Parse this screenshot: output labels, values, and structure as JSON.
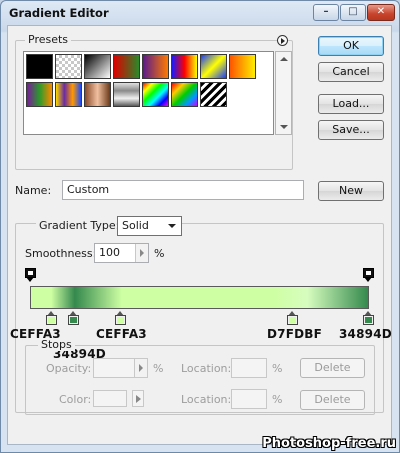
{
  "window": {
    "title": "Gradient Editor",
    "minimize_glyph": "–",
    "maximize_glyph": "□",
    "close_glyph": "✕"
  },
  "presets": {
    "label": "Presets",
    "swatches": [
      {
        "name": "black-fill",
        "background": "#000000"
      },
      {
        "name": "checker-transparent",
        "background": "repeating-conic-gradient(#c8c8c8 0% 25%, #ffffff 0% 50%) 0 0/6px 6px"
      },
      {
        "name": "black-to-white",
        "background": "linear-gradient(135deg,#000,#fff)"
      },
      {
        "name": "red-green",
        "background": "linear-gradient(to right,#d00,#2a8a2a)"
      },
      {
        "name": "violet-orange",
        "background": "linear-gradient(to right,#5a1a8a,#ff7a00)"
      },
      {
        "name": "blue-red-yellow",
        "background": "linear-gradient(to right,#1a1aff,#ff0000,#ffff00)"
      },
      {
        "name": "blue-yellow-blue",
        "background": "linear-gradient(135deg,#1a3cff,#ffff00,#1a3cff)"
      },
      {
        "name": "orange-yellow",
        "background": "linear-gradient(to right,#ff5500,#ffee00)"
      },
      {
        "name": "violet-green-orange",
        "background": "linear-gradient(to right,#7a1a9a,#2a9a2a,#ff8a00)"
      },
      {
        "name": "yellow-violet-orange-blue",
        "background": "linear-gradient(to right,#ffd800,#6a2aa0,#ff9a00,#1a4aff)"
      },
      {
        "name": "copper",
        "background": "linear-gradient(to right,#8a4a2a,#f0c0a0,#6a3a1a)"
      },
      {
        "name": "chrome",
        "background": "linear-gradient(to bottom,#e0e0e0,#8a8a8a,#f0f0f0,#5a5a5a)"
      },
      {
        "name": "spectrum",
        "background": "linear-gradient(135deg,#ff0000,#ffff00,#00ff00,#00ffff,#0000ff,#ff00ff)"
      },
      {
        "name": "transparent-rainbow",
        "background": "linear-gradient(135deg,#ff0000,#ffcc00,#00cc00,#0099ff,#cc00ff)"
      },
      {
        "name": "transparent-stripes",
        "background": "repeating-linear-gradient(135deg,#000 0 3px,#fff 3px 6px)"
      }
    ]
  },
  "buttons": {
    "ok": "OK",
    "cancel": "Cancel",
    "load": "Load...",
    "save": "Save...",
    "new": "New",
    "delete_opacity": "Delete",
    "delete_color": "Delete"
  },
  "name": {
    "label": "Name:",
    "value": "Custom"
  },
  "gradient": {
    "type_label": "Gradient Type:",
    "type_value": "Solid",
    "smoothness_label": "Smoothness:",
    "smoothness_value": "100",
    "percent": "%"
  },
  "stop_notes": [
    "CEFFA3",
    "34894D",
    "CEFFA3",
    "D7FDBF",
    "34894D"
  ],
  "stops": {
    "label": "Stops",
    "opacity_label": "Opacity:",
    "location_label": "Location:",
    "color_label": "Color:",
    "percent": "%"
  },
  "watermark": "Photoshop-free.ru",
  "colors": {
    "light_green": "#CEFFA3",
    "dark_green": "#34894D",
    "pale_green": "#D7FDBF"
  }
}
